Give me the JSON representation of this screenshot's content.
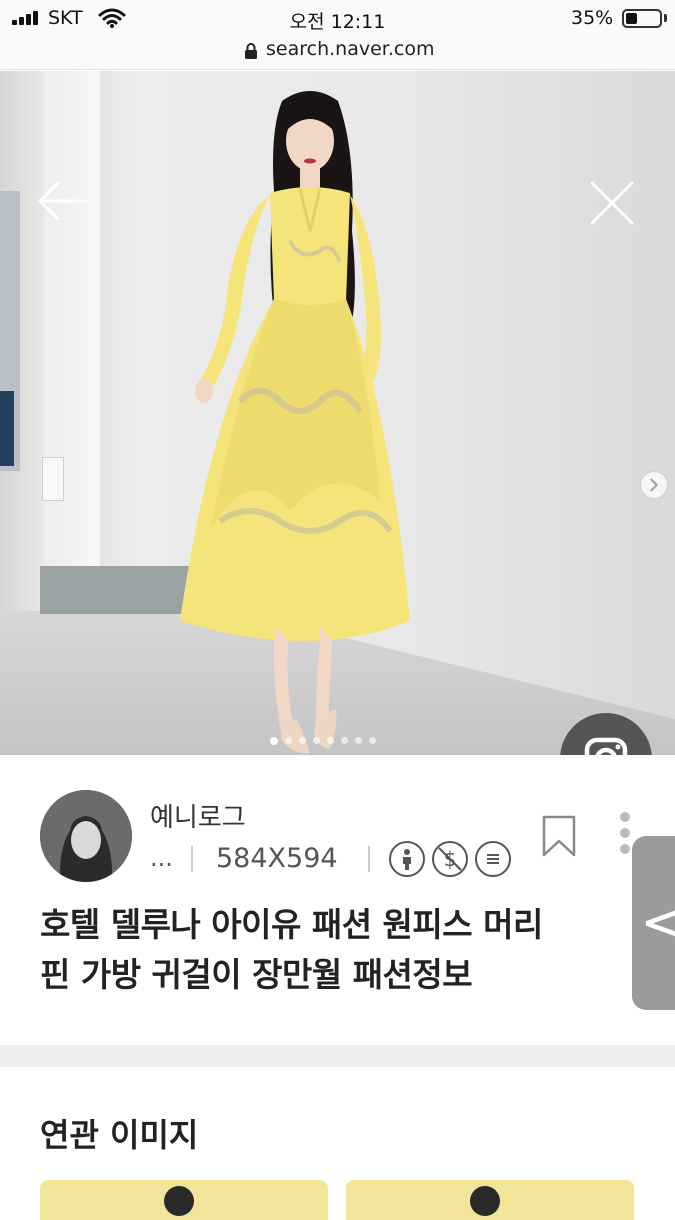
{
  "status_bar": {
    "carrier": "SKT",
    "time": "오전 12:11",
    "battery_percent": "35%",
    "battery_level": 0.35,
    "icons": [
      "signal-icon",
      "wifi-icon",
      "battery-icon"
    ]
  },
  "url_bar": {
    "url": "search.naver.com",
    "icon": "lock-icon"
  },
  "viewer": {
    "icons": [
      "back-arrow-icon",
      "close-icon",
      "next-icon",
      "lens-search-icon"
    ],
    "page_count": 8,
    "current_page": 1
  },
  "result": {
    "source_name": "예니로그",
    "ellipsis": "...",
    "image_size": "584X594",
    "meta_icons": [
      "person-icon",
      "no-dollar-icon",
      "menu-lines-icon"
    ],
    "title_line1": "호텔 델루나 아이유 패션 원피스 머리",
    "title_line2": "핀 가방 귀걸이 장만월 패션정보"
  },
  "side_tab": {
    "label": "<"
  },
  "related": {
    "title": "연관 이미지"
  },
  "colors": {
    "dress_yellow": "#f4e47a",
    "lens_button": "#555555",
    "side_tab": "#9b9b9b",
    "band": "#eeeeee"
  }
}
